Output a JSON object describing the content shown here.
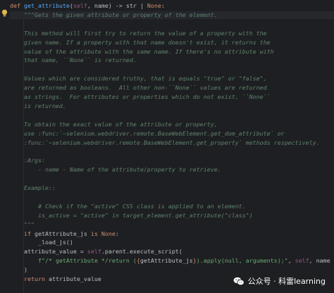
{
  "code_lines": [
    {
      "segments": [
        {
          "t": "def ",
          "c": "kw"
        },
        {
          "t": "get_attribute",
          "c": "fn"
        },
        {
          "t": "(",
          "c": "plain"
        },
        {
          "t": "self",
          "c": "self"
        },
        {
          "t": ", name) -> str | ",
          "c": "plain"
        },
        {
          "t": "None",
          "c": "none"
        },
        {
          "t": ":",
          "c": "plain"
        }
      ]
    },
    {
      "segments": [
        {
          "t": "    \"\"\"Gets the given attribute or property of the element.",
          "c": "doc"
        }
      ]
    },
    {
      "segments": [
        {
          "t": "",
          "c": "doc"
        }
      ]
    },
    {
      "segments": [
        {
          "t": "    This method will first try to return the value of a property with the",
          "c": "doc"
        }
      ]
    },
    {
      "segments": [
        {
          "t": "    given name. If a property with that name doesn't exist, it returns the",
          "c": "doc"
        }
      ]
    },
    {
      "segments": [
        {
          "t": "    value of the attribute with the same name. If there's no attribute with",
          "c": "doc"
        }
      ]
    },
    {
      "segments": [
        {
          "t": "    that name, ``None`` is returned.",
          "c": "doc"
        }
      ]
    },
    {
      "segments": [
        {
          "t": "",
          "c": "doc"
        }
      ]
    },
    {
      "segments": [
        {
          "t": "    Values which are considered truthy, that is equals \"true\" or \"false\",",
          "c": "doc"
        }
      ]
    },
    {
      "segments": [
        {
          "t": "    are returned as booleans.  All other non-``None`` values are returned",
          "c": "doc"
        }
      ]
    },
    {
      "segments": [
        {
          "t": "    as strings.  For attributes or properties which do not exist, ``None``",
          "c": "doc"
        }
      ]
    },
    {
      "segments": [
        {
          "t": "    is returned.",
          "c": "doc"
        }
      ]
    },
    {
      "segments": [
        {
          "t": "",
          "c": "doc"
        }
      ]
    },
    {
      "segments": [
        {
          "t": "    To obtain the exact value of the attribute or property,",
          "c": "doc"
        }
      ]
    },
    {
      "segments": [
        {
          "t": "    use :func:`~selenium.webdriver.remote.BaseWebElement.get_dom_attribute` or",
          "c": "doc"
        }
      ]
    },
    {
      "segments": [
        {
          "t": "    :func:`~selenium.webdriver.remote.BaseWebElement.get_property` methods respectively.",
          "c": "doc"
        }
      ]
    },
    {
      "segments": [
        {
          "t": "",
          "c": "doc"
        }
      ]
    },
    {
      "segments": [
        {
          "t": "    :Args:",
          "c": "doc"
        }
      ]
    },
    {
      "segments": [
        {
          "t": "        - name - Name of the attribute/property to retrieve.",
          "c": "doc"
        }
      ]
    },
    {
      "segments": [
        {
          "t": "",
          "c": "doc"
        }
      ]
    },
    {
      "segments": [
        {
          "t": "    Example::",
          "c": "doc"
        }
      ]
    },
    {
      "segments": [
        {
          "t": "",
          "c": "doc"
        }
      ]
    },
    {
      "segments": [
        {
          "t": "        # Check if the \"active\" CSS class is applied to an element.",
          "c": "doc"
        }
      ]
    },
    {
      "segments": [
        {
          "t": "        is_active = \"active\" in target_element.get_attribute(\"class\")",
          "c": "doc"
        }
      ]
    },
    {
      "segments": [
        {
          "t": "    \"\"\"",
          "c": "doc"
        }
      ]
    },
    {
      "segments": [
        {
          "t": "    ",
          "c": "plain"
        },
        {
          "t": "if ",
          "c": "kw"
        },
        {
          "t": "getAttribute_js ",
          "c": "plain"
        },
        {
          "t": "is ",
          "c": "kw"
        },
        {
          "t": "None",
          "c": "none"
        },
        {
          "t": ":",
          "c": "plain"
        }
      ]
    },
    {
      "segments": [
        {
          "t": "        _load_js()",
          "c": "plain"
        }
      ]
    },
    {
      "segments": [
        {
          "t": "    attribute_value = ",
          "c": "plain"
        },
        {
          "t": "self",
          "c": "self"
        },
        {
          "t": ".parent.execute_script(",
          "c": "plain"
        }
      ]
    },
    {
      "segments": [
        {
          "t": "        ",
          "c": "plain"
        },
        {
          "t": "f\"/* getAttribute */return (",
          "c": "fstr"
        },
        {
          "t": "{",
          "c": "brace"
        },
        {
          "t": "getAttribute_js",
          "c": "plain"
        },
        {
          "t": "}",
          "c": "brace"
        },
        {
          "t": ").apply(null, arguments);\"",
          "c": "fstr"
        },
        {
          "t": ", ",
          "c": "plain"
        },
        {
          "t": "self",
          "c": "self"
        },
        {
          "t": ", name",
          "c": "plain"
        }
      ]
    },
    {
      "segments": [
        {
          "t": "    )",
          "c": "plain"
        }
      ]
    },
    {
      "segments": [
        {
          "t": "    ",
          "c": "plain"
        },
        {
          "t": "return ",
          "c": "kw"
        },
        {
          "t": "attribute_value",
          "c": "plain"
        }
      ]
    }
  ],
  "current_line_index": 1,
  "gutter": {
    "icon": "bulb-icon",
    "color": "#e0b54c"
  },
  "watermark": {
    "icon": "wechat-icon",
    "text": "公众号 · 科雷learning"
  },
  "colors": {
    "background": "#1e1f22",
    "keyword": "#cf8e6d",
    "function": "#56a8f5",
    "self": "#94558d",
    "docstring": "#5f826b",
    "string": "#6aab73",
    "plain": "#bcbec4"
  }
}
